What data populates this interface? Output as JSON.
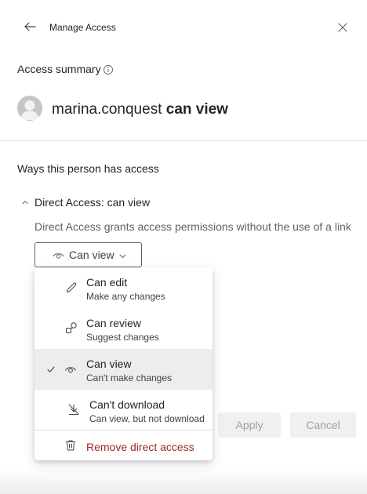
{
  "header": {
    "title": "Manage Access",
    "back_icon": "arrow-left-icon",
    "close_icon": "close-icon"
  },
  "summary": {
    "label": "Access summary",
    "info_icon": "info-icon",
    "user_name": "marina.conquest",
    "permission_text": "can view"
  },
  "ways": {
    "label": "Ways this person has access",
    "direct_title": "Direct Access: can view",
    "direct_description": "Direct Access grants access permissions without the use of a link",
    "selected_permission": "Can view"
  },
  "dropdown": {
    "options": [
      {
        "title": "Can edit",
        "subtitle": "Make any changes",
        "icon": "pencil-icon",
        "selected": false
      },
      {
        "title": "Can review",
        "subtitle": "Suggest changes",
        "icon": "review-icon",
        "selected": false
      },
      {
        "title": "Can view",
        "subtitle": "Can't make changes",
        "icon": "eye-icon",
        "selected": true
      },
      {
        "title": "Can't download",
        "subtitle": "Can view, but not download",
        "icon": "no-download-icon",
        "selected": false
      }
    ],
    "remove_label": "Remove direct access",
    "remove_icon": "trash-icon"
  },
  "footer": {
    "apply_label": "Apply",
    "cancel_label": "Cancel"
  },
  "colors": {
    "danger": "#a4262c",
    "selected_bg": "#ededed",
    "disabled_text": "#a0a0a0"
  }
}
